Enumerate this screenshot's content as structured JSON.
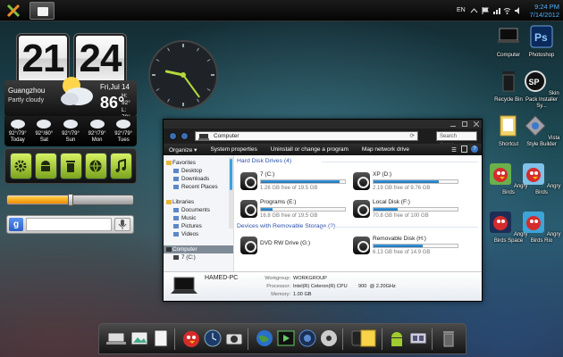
{
  "topbar": {
    "language": "EN",
    "time": "9:24 PM",
    "date": "7/14/2012"
  },
  "weather_widget": {
    "hours": "21",
    "minutes": "24",
    "city": "Guangzhou",
    "condition": "Partly cloudy",
    "date": "Fri,Jul 14",
    "temperature": "86°",
    "high": "H: 92°",
    "low": "L: 79°",
    "forecast": [
      {
        "temps": "92°/79°",
        "day": "Today"
      },
      {
        "temps": "92°/80°",
        "day": "Sat"
      },
      {
        "temps": "92°/79°",
        "day": "Sun"
      },
      {
        "temps": "92°/79°",
        "day": "Mon"
      },
      {
        "temps": "92°/79°",
        "day": "Tues"
      }
    ]
  },
  "analog_clock": {
    "hour": 9,
    "minute": 24
  },
  "volume_slider": {
    "level_percent": 50
  },
  "google_search": {
    "placeholder": ""
  },
  "desktop_icons": [
    {
      "label": "Computer"
    },
    {
      "label": "Photoshop"
    },
    {
      "label": "Recycle Bin"
    },
    {
      "label": "Skin Pack Installer Sy..."
    },
    {
      "label": "Shortcut"
    },
    {
      "label": "Vista Style Builder"
    },
    {
      "label": "Angry Birds"
    },
    {
      "label": "Angry Birds"
    },
    {
      "label": "Angry Birds Space"
    },
    {
      "label": "Angry Birds Rio"
    }
  ],
  "explorer": {
    "address": "Computer",
    "search_placeholder": "Search Comp...",
    "commands": [
      "Organize ▾",
      "System properties",
      "Uninstall or change a program",
      "Map network drive"
    ],
    "nav": {
      "favorites": "Favorites",
      "fav_items": [
        "Desktop",
        "Downloads",
        "Recent Places"
      ],
      "libraries": "Libraries",
      "lib_items": [
        "Documents",
        "Music",
        "Pictures",
        "Videos"
      ],
      "computer": "Computer",
      "comp_items": [
        "7 (C:)"
      ]
    },
    "hdd_group": "Hard Disk Drives (4)",
    "drives": [
      {
        "name": "7 (C:)",
        "free": "1.26 GB free of 19.5 GB",
        "used_fraction": 0.94
      },
      {
        "name": "XP (D:)",
        "free": "2.19 GB free of 9.76 GB",
        "used_fraction": 0.78
      },
      {
        "name": "Programs (E:)",
        "free": "16.8 GB free of 19.5 GB",
        "used_fraction": 0.14
      },
      {
        "name": "Local Disk (F:)",
        "free": "70.8 GB free of 100 GB",
        "used_fraction": 0.29
      }
    ],
    "removable_group": "Devices with Removable Storage (2)",
    "removable": [
      {
        "name": "DVD RW Drive (G:)",
        "free": ""
      },
      {
        "name": "Removable Disk (H:)",
        "free": "6.13 GB free of 14.9 GB",
        "used_fraction": 0.59
      }
    ],
    "details": {
      "pc_name": "HAMED-PC",
      "workgroup_label": "Workgroup:",
      "workgroup": "WORKGROUP",
      "processor_label": "Processor:",
      "processor": "Intel(R) Celeron(R) CPU        900  @ 2.20GHz",
      "memory_label": "Memory:",
      "memory": "1.00 GB"
    }
  },
  "colors": {
    "accent": "#4fb0ff",
    "app_green": "#9fcc2e"
  }
}
